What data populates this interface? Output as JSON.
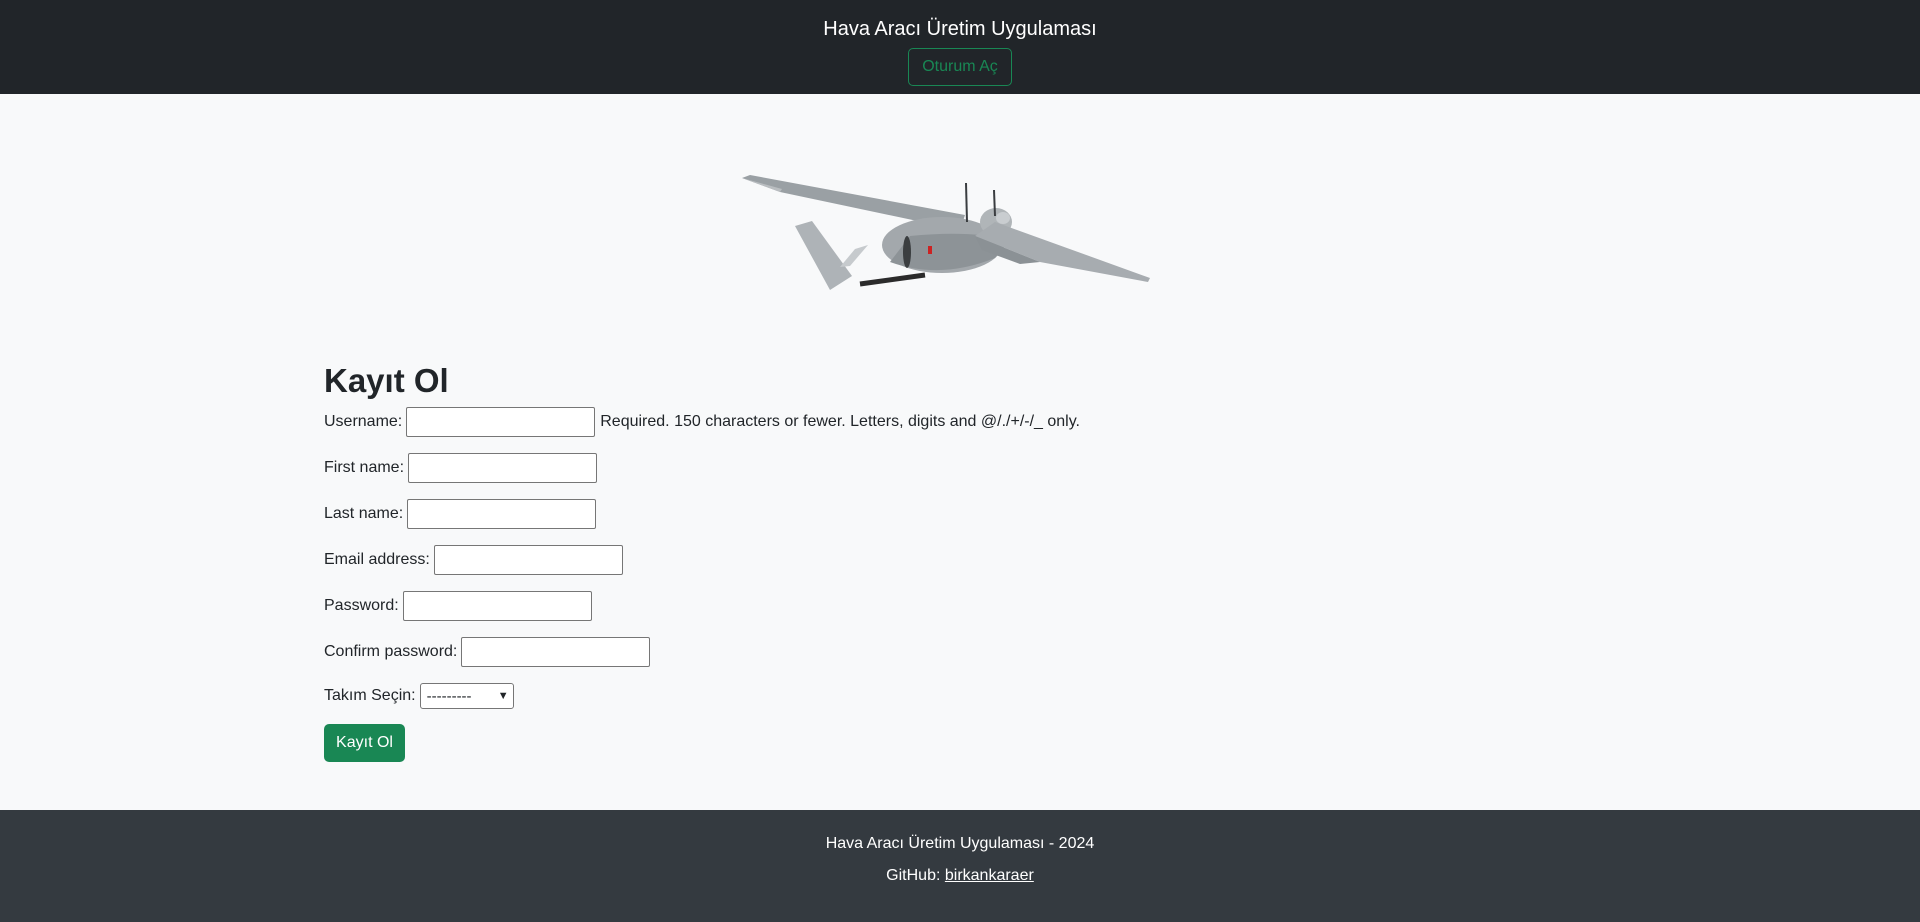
{
  "header": {
    "title": "Hava Aracı Üretim Uygulaması",
    "login_label": "Oturum Aç"
  },
  "hero": {
    "image": "drone-image"
  },
  "form": {
    "heading": "Kayıt Ol",
    "fields": {
      "username": {
        "label": "Username:",
        "value": "",
        "help": "Required. 150 characters or fewer. Letters, digits and @/./+/-/_ only."
      },
      "first_name": {
        "label": "First name:",
        "value": ""
      },
      "last_name": {
        "label": "Last name:",
        "value": ""
      },
      "email": {
        "label": "Email address:",
        "value": ""
      },
      "password": {
        "label": "Password:",
        "value": ""
      },
      "confirm_password": {
        "label": "Confirm password:",
        "value": ""
      }
    },
    "team": {
      "label": "Takım Seçin:",
      "selected": "---------"
    },
    "submit_label": "Kayıt Ol"
  },
  "footer": {
    "copyright": "Hava Aracı Üretim Uygulaması - 2024",
    "github_label": "GitHub:",
    "github_link": "birkankaraer"
  },
  "colors": {
    "navbar": "#212529",
    "footer": "#343a40",
    "success": "#198754",
    "page": "#f8f9fa"
  }
}
